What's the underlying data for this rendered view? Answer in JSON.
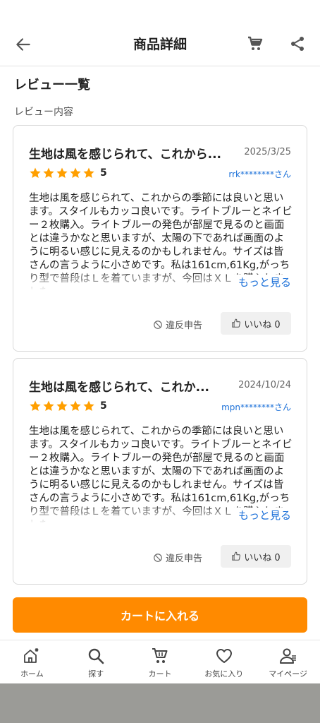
{
  "header": {
    "title": "商品詳細",
    "back_icon": "arrow-left-icon",
    "cart_icon": "cart-icon",
    "share_icon": "share-icon"
  },
  "section": {
    "title": "レビュー一覧",
    "subtitle": "レビュー内容"
  },
  "reviews": [
    {
      "title": "生地は風を感じられて、これから...",
      "date": "2025/3/25",
      "rating": 5,
      "score_label": "5",
      "user": "rrk********さん",
      "body": "生地は風を感じられて、これからの季節には良いと思います。スタイルもカッコ良いです。ライトブルーとネイビー２枚購入。ライトブルーの発色が部屋で見るのと画面とは違うかなと思いますが、太陽の下であれば画面のように明るい感じに見えるのかもしれません。サイズは皆さんの言うように小さめです。私は161cm,61Kg,がっちり型で普段はＬを着ていますが、今回はＸＬを購入しました。",
      "more_label": "もっと見る",
      "report_label": "違反申告",
      "like_label": "いいね 0"
    },
    {
      "title": "生地は風を感じられて、これか...",
      "date": "2024/10/24",
      "rating": 5,
      "score_label": "5",
      "user": "mpn********さん",
      "body": "生地は風を感じられて、これからの季節には良いと思います。スタイルもカッコ良いです。ライトブルーとネイビー２枚購入。ライトブルーの発色が部屋で見るのと画面とは違うかなと思いますが、太陽の下であれば画面のように明るい感じに見えるのかもしれません。サイズは皆さんの言うように小さめです。私は161cm,61Kg,がっちり型で普段はＬを着ていますが、今回はＸＬを購入しました。",
      "more_label": "もっと見る",
      "report_label": "違反申告",
      "like_label": "いいね 0"
    }
  ],
  "cart_button": {
    "label": "カートに入れる"
  },
  "tabs": [
    {
      "label": "ホーム",
      "icon": "home-icon"
    },
    {
      "label": "探す",
      "icon": "search-icon"
    },
    {
      "label": "カート",
      "icon": "cart-icon"
    },
    {
      "label": "お気に入り",
      "icon": "heart-icon"
    },
    {
      "label": "マイページ",
      "icon": "user-icon"
    }
  ],
  "colors": {
    "accent": "#ff8a00",
    "star": "#ff9f00",
    "link": "#1a6fd8"
  }
}
